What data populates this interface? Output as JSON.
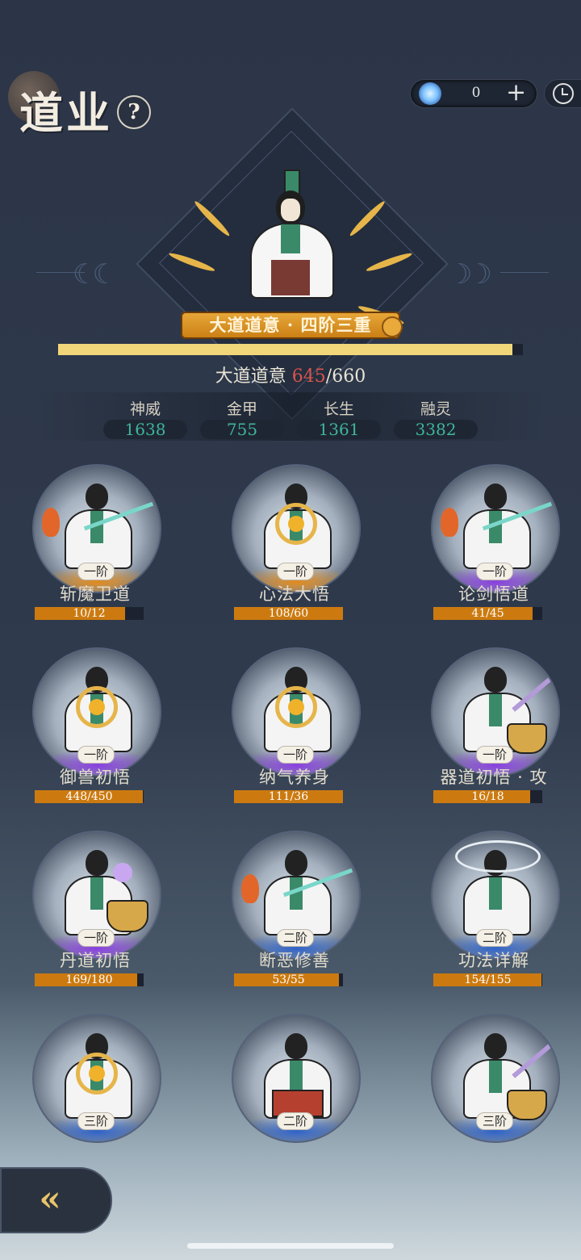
{
  "header": {
    "title": "道业",
    "help_label": "?",
    "currency_value": "0",
    "plus_label": "+"
  },
  "hero": {
    "banner": "大道道意 · 四阶三重",
    "progress_label": "大道道意",
    "progress_current": "645",
    "progress_max": "/660",
    "progress_fraction": 0.977,
    "stats": [
      {
        "label": "神威",
        "value": "1638"
      },
      {
        "label": "金甲",
        "value": "755"
      },
      {
        "label": "长生",
        "value": "1361"
      },
      {
        "label": "融灵",
        "value": "3382"
      }
    ]
  },
  "skills": [
    {
      "name": "斩魔卫道",
      "tier": "一阶",
      "progress": "10/12",
      "fill": 0.83,
      "glow": "orange",
      "prop": "duel"
    },
    {
      "name": "心法大悟",
      "tier": "一阶",
      "progress": "108/60",
      "fill": 1.0,
      "glow": "orange",
      "prop": "orb"
    },
    {
      "name": "论剑悟道",
      "tier": "一阶",
      "progress": "41/45",
      "fill": 0.91,
      "glow": "purple",
      "prop": "duel"
    },
    {
      "name": "御兽初悟",
      "tier": "一阶",
      "progress": "448/450",
      "fill": 0.99,
      "glow": "purple",
      "prop": "orb"
    },
    {
      "name": "纳气养身",
      "tier": "一阶",
      "progress": "111/36",
      "fill": 1.0,
      "glow": "purple",
      "prop": "orb"
    },
    {
      "name": "器道初悟 · 攻",
      "tier": "一阶",
      "progress": "16/18",
      "fill": 0.89,
      "glow": "purple",
      "prop": "sword"
    },
    {
      "name": "丹道初悟",
      "tier": "一阶",
      "progress": "169/180",
      "fill": 0.94,
      "glow": "purple",
      "prop": "cauldron"
    },
    {
      "name": "断恶修善",
      "tier": "二阶",
      "progress": "53/55",
      "fill": 0.96,
      "glow": "blue",
      "prop": "duel"
    },
    {
      "name": "功法详解",
      "tier": "二阶",
      "progress": "154/155",
      "fill": 0.99,
      "glow": "blue",
      "prop": "wings"
    },
    {
      "name": "",
      "tier": "三阶",
      "progress": "",
      "fill": 0,
      "glow": "blue",
      "prop": "orb"
    },
    {
      "name": "",
      "tier": "二阶",
      "progress": "",
      "fill": 0,
      "glow": "blue",
      "prop": "chest"
    },
    {
      "name": "",
      "tier": "三阶",
      "progress": "",
      "fill": 0,
      "glow": "blue",
      "prop": "sword"
    }
  ],
  "colors": {
    "orange": "#e08a1c",
    "purple": "#8a3fe0",
    "blue": "#2f63c8"
  }
}
